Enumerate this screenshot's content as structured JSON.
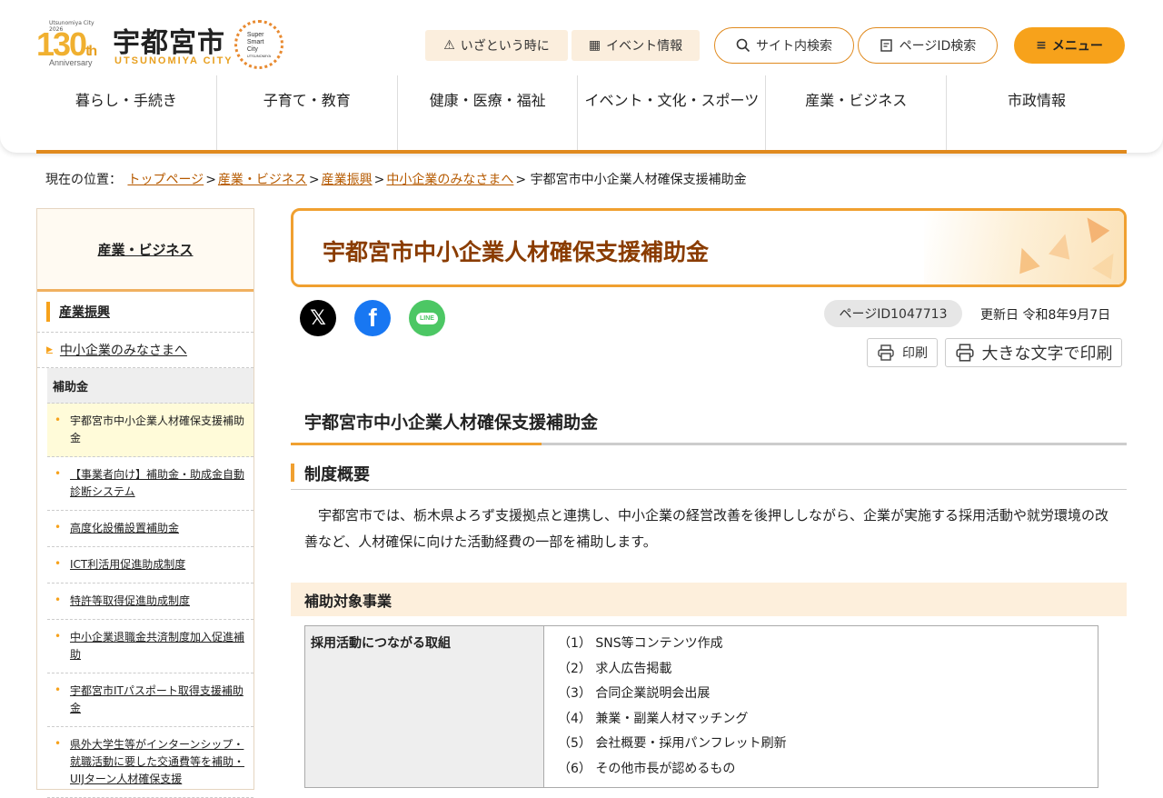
{
  "header": {
    "logo": {
      "anniv_small": "Utsunomiya City 2026",
      "num": "130",
      "th": "th",
      "anniv": "Anniversary",
      "city_name": "宇都宮市",
      "city_roman": "UTSUNOMIYA CITY",
      "ssc_lines": [
        "Super",
        "Smart",
        "City",
        "UTSUNOMIYA"
      ]
    },
    "buttons": {
      "emergency": "いざという時に",
      "events": "イベント情報",
      "search": "サイト内検索",
      "pageid_search": "ページID検索",
      "menu": "メニュー"
    },
    "nav": [
      "暮らし・手続き",
      "子育て・教育",
      "健康・医療・福祉",
      "イベント・文化・スポーツ",
      "産業・ビジネス",
      "市政情報"
    ]
  },
  "breadcrumb": {
    "prefix": "現在の位置：",
    "links": [
      "トップページ",
      "産業・ビジネス",
      "産業振興",
      "中小企業のみなさまへ"
    ],
    "current": "宇都宮市中小企業人材確保支援補助金"
  },
  "sidebar": {
    "title": "産業・ビジネス",
    "section": "産業振興",
    "sub": "中小企業のみなさまへ",
    "category": "補助金",
    "links": [
      "宇都宮市中小企業人材確保支援補助金",
      "【事業者向け】補助金・助成金自動診断システム",
      "高度化設備設置補助金",
      "ICT利活用促進助成制度",
      "特許等取得促進助成制度",
      "中小企業退職金共済制度加入促進補助",
      "宇都宮市ITパスポート取得支援補助金",
      "県外大学生等がインターンシップ・就職活動に要した交通費等を補助・UIJターン人材確保支援"
    ]
  },
  "main": {
    "title": "宇都宮市中小企業人材確保支援補助金",
    "social": {
      "x": "𝕏",
      "facebook": "f",
      "line": "LINE"
    },
    "page_id": "ページID1047713",
    "updated": "更新日 令和8年9月7日",
    "print": "印刷",
    "print_large": "大きな文字で印刷",
    "h2": "宇都宮市中小企業人材確保支援補助金",
    "h3": "制度概要",
    "paragraph": "宇都宮市では、栃木県よろず支援拠点と連携し、中小企業の経営改善を後押ししながら、企業が実施する採用活動や就労環境の改善など、人材確保に向けた活動経費の一部を補助します。",
    "h4": "補助対象事業",
    "table": {
      "header": "採用活動につながる取組",
      "items": [
        "（1） SNS等コンテンツ作成",
        "（2） 求人広告掲載",
        "（3） 合同企業説明会出展",
        "（4） 兼業・副業人材マッチング",
        "（5） 会社概要・採用パンフレット刷新",
        "（6） その他市長が認めるもの"
      ]
    }
  },
  "colors": {
    "accent": "#f7a21b",
    "title": "#8a3c00",
    "link": "#b65a00"
  }
}
